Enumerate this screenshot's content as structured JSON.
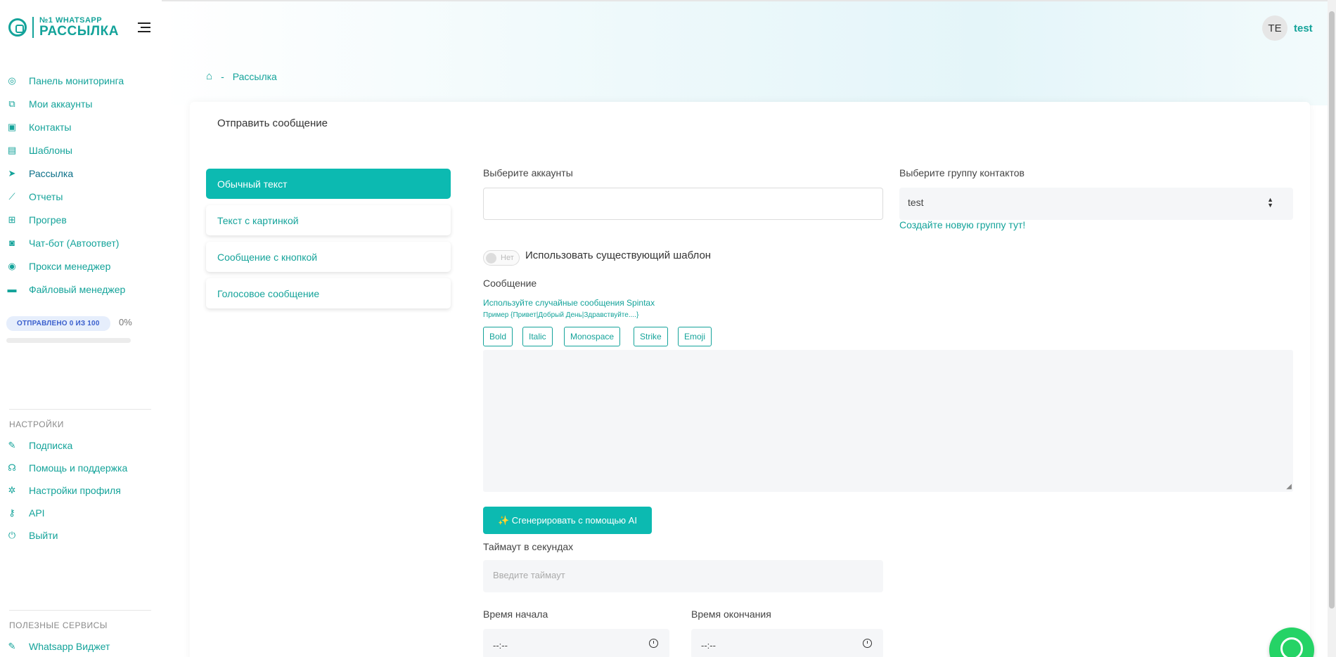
{
  "brand": {
    "top": "WHATSAPP",
    "badge": "№1",
    "bottom": "РАССЫЛКА"
  },
  "user": {
    "initials": "TE",
    "name": "test"
  },
  "sidebar": {
    "items": [
      {
        "label": "Панель мониторинга",
        "icon": "dashboard-icon"
      },
      {
        "label": "Мои аккаунты",
        "icon": "accounts-icon"
      },
      {
        "label": "Контакты",
        "icon": "contacts-icon"
      },
      {
        "label": "Шаблоны",
        "icon": "templates-icon"
      },
      {
        "label": "Рассылка",
        "icon": "send-icon"
      },
      {
        "label": "Отчеты",
        "icon": "rocket-icon"
      },
      {
        "label": "Прогрев",
        "icon": "apps-icon"
      },
      {
        "label": "Чат-бот (Автоответ)",
        "icon": "robot-icon"
      },
      {
        "label": "Прокси менеджер",
        "icon": "globe-icon"
      },
      {
        "label": "Файловый менеджер",
        "icon": "folder-icon"
      }
    ],
    "sent_badge": "ОТПРАВЛЕНО 0 ИЗ 100",
    "sent_percent": "0%",
    "sent_progress": 0,
    "settings_title": "НАСТРОЙКИ",
    "settings_items": [
      {
        "label": "Подписка",
        "icon": "subscription-icon"
      },
      {
        "label": "Помощь и поддержка",
        "icon": "support-icon"
      },
      {
        "label": "Настройки профиля",
        "icon": "gear-icon"
      },
      {
        "label": "API",
        "icon": "key-icon"
      },
      {
        "label": "Выйти",
        "icon": "power-icon"
      }
    ],
    "services_title": "ПОЛЕЗНЫЕ СЕРВИСЫ",
    "services_items": [
      {
        "label": "Whatsapp Виджет",
        "icon": "widget-icon"
      }
    ]
  },
  "breadcrumb": {
    "current": "Рассылка"
  },
  "card": {
    "title": "Отправить сообщение",
    "tabs": [
      "Обычный текст",
      "Текст с картинкой",
      "Сообщение с кнопкой",
      "Голосовое сообщение"
    ],
    "accounts_label": "Выберите аккаунты",
    "group_label": "Выберите группу контактов",
    "group_value": "test",
    "create_group_link": "Создайте новую группу тут!",
    "toggle_off_label": "Нет",
    "use_template_label": "Использовать существующий шаблон",
    "message_label": "Сообщение",
    "spintax_hint": "Используйте случайные сообщения Spintax",
    "spintax_example": "Пример {Привет|Добрый День|Здравствуйте....}",
    "format_buttons": [
      "Bold",
      "Italic",
      "Monospace",
      "Strike",
      "Emoji"
    ],
    "ai_button": "✨ Сгенерировать с помощью AI",
    "timeout_label": "Таймаут в секундах",
    "timeout_placeholder": "Введите таймаут",
    "start_label": "Время начала",
    "end_label": "Время окончания",
    "start_value": "--:--",
    "end_value": "--:--"
  }
}
